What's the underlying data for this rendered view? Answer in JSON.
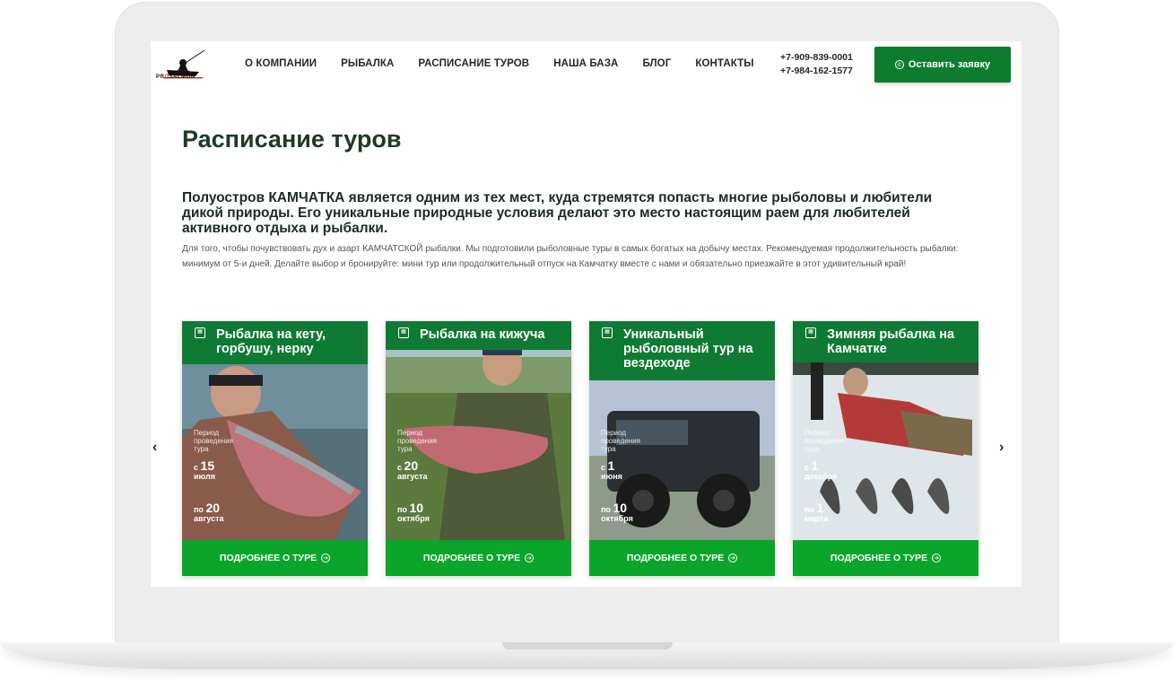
{
  "header": {
    "logo_text_a": "PR",
    "logo_text_b": "O",
    "logo_text_c": "SALMON",
    "nav": [
      "О КОМПАНИИ",
      "РЫБАЛКА",
      "РАСПИСАНИЕ ТУРОВ",
      "НАША БАЗА",
      "БЛОГ",
      "КОНТАКТЫ"
    ],
    "phones": [
      "+7-909-839-0001",
      "+7-984-162-1577"
    ],
    "cta_label": "Оставить заявку"
  },
  "page": {
    "title": "Расписание туров",
    "lead": "Полуостров КАМЧАТКА является одним из тех мест, куда стремятся попасть многие рыболовы и любители дикой природы. Его уникальные природные условия делают это место настоящим раем для любителей активного отдыха и рыбалки.",
    "description": "Для того, чтобы почувствовать дух и азарт КАМЧАТСКОЙ рыбалки. Мы подготовили рыболовные туры в самых богатых на добычу местах. Рекомендуемая продолжительность рыбалки: минимум от 5-и дней. Делайте выбор и бронируйте: мини тур или продолжительный отпуск на Камчатку вместе с нами и обязательно приезжайте в этот удивительный край!"
  },
  "carousel": {
    "prev": "‹",
    "next": "›",
    "cards": [
      {
        "title": "Рыбалка на кету, горбушу, нерку",
        "period": "Период проведения тура",
        "from_prefix": "с",
        "from_day": "15",
        "from_month": "июля",
        "to_prefix": "по",
        "to_day": "20",
        "to_month": "августа",
        "button": "ПОДРОБНЕЕ О ТУРЕ"
      },
      {
        "title": "Рыбалка на кижуча",
        "period": "Период проведения тура",
        "from_prefix": "с",
        "from_day": "20",
        "from_month": "августа",
        "to_prefix": "по",
        "to_day": "10",
        "to_month": "октября",
        "button": "ПОДРОБНЕЕ О ТУРЕ"
      },
      {
        "title": "Уникальный рыболовный тур на вездеходе",
        "period": "Период проведения тура",
        "from_prefix": "с",
        "from_day": "1",
        "from_month": "июня",
        "to_prefix": "по",
        "to_day": "10",
        "to_month": "октября",
        "button": "ПОДРОБНЕЕ О ТУРЕ"
      },
      {
        "title": "Зимняя рыбалка на Камчатке",
        "period": "Период проведения тура",
        "from_prefix": "с",
        "from_day": "1",
        "from_month": "декабря",
        "to_prefix": "по",
        "to_day": "1",
        "to_month": "марта",
        "button": "ПОДРОБНЕЕ О ТУРЕ"
      }
    ]
  },
  "icons": {
    "card_badge": "calendar-icon",
    "cta": "whatsapp-icon",
    "button": "arrow-circle-right-icon"
  },
  "colors": {
    "brand_green": "#0e7c2f",
    "button_green": "#0aa52a",
    "title": "#1c3a24"
  }
}
